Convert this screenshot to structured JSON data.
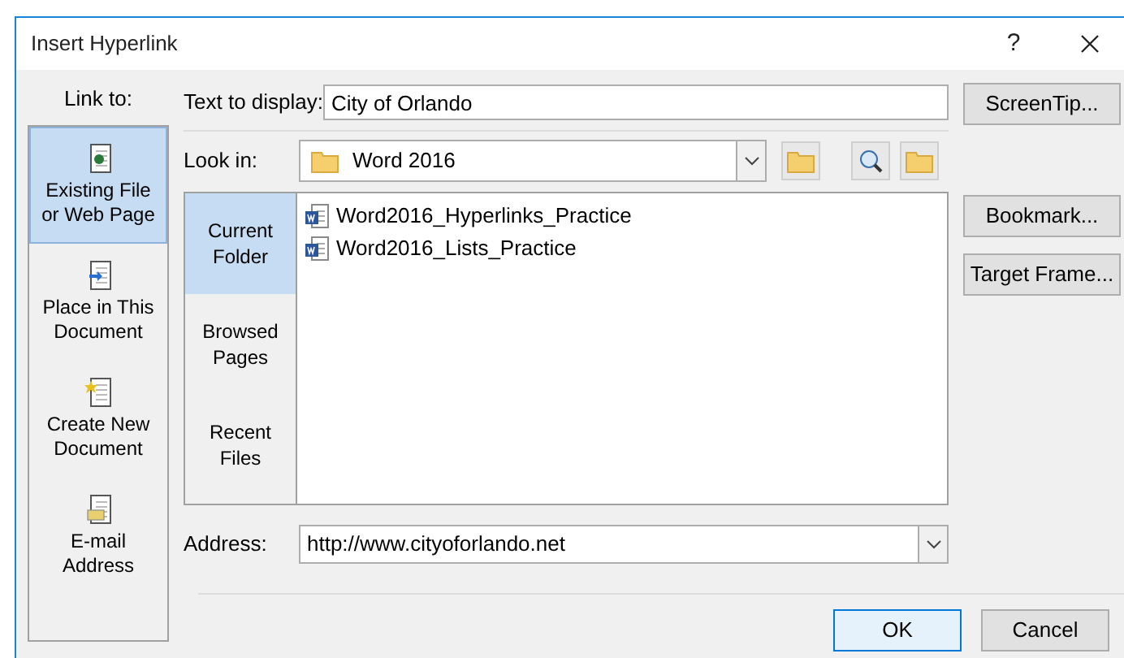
{
  "window": {
    "title": "Insert Hyperlink",
    "help": "?"
  },
  "link_to": {
    "label": "Link to:",
    "items": [
      {
        "kind": "file",
        "label": "Existing File or Web Page",
        "selected": true
      },
      {
        "kind": "place",
        "label": "Place in This Document",
        "selected": false
      },
      {
        "kind": "new",
        "label": "Create New Document",
        "selected": false
      },
      {
        "kind": "email",
        "label": "E-mail Address",
        "selected": false
      }
    ]
  },
  "text_to_display": {
    "label": "Text to display:",
    "value": "City of Orlando"
  },
  "look_in": {
    "label": "Look in:",
    "value": "Word 2016"
  },
  "views": [
    {
      "label": "Current Folder",
      "selected": true
    },
    {
      "label": "Browsed Pages",
      "selected": false
    },
    {
      "label": "Recent Files",
      "selected": false
    }
  ],
  "files": [
    {
      "name": "Word2016_Hyperlinks_Practice"
    },
    {
      "name": "Word2016_Lists_Practice"
    }
  ],
  "address": {
    "label": "Address:",
    "value": "http://www.cityoforlando.net"
  },
  "side_buttons": [
    "ScreenTip...",
    "Bookmark...",
    "Target Frame..."
  ],
  "buttons": [
    {
      "label": "OK",
      "default": true
    },
    {
      "label": "Cancel",
      "default": false
    }
  ]
}
